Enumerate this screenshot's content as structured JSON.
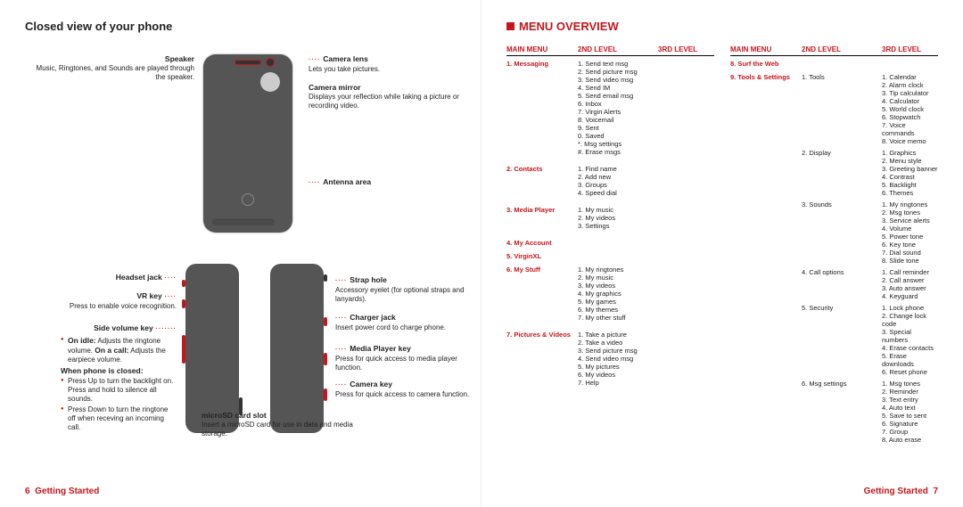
{
  "left": {
    "title": "Closed view of your phone",
    "labels": {
      "speaker": {
        "h": "Speaker",
        "d": "Music, Ringtones, and Sounds are played through the speaker."
      },
      "camera_lens": {
        "h": "Camera lens",
        "d": "Lets you take pictures."
      },
      "camera_mirror": {
        "h": "Camera mirror",
        "d": "Displays your reflection while taking a picture or recording video."
      },
      "antenna": {
        "h": "Antenna area"
      },
      "headset": {
        "h": "Headset jack"
      },
      "vr": {
        "h": "VR key",
        "d": "Press to enable voice recognition."
      },
      "strap": {
        "h": "Strap hole",
        "d": "Accessory eyelet (for optional straps and lanyards)."
      },
      "side_vol": {
        "h": "Side volume key",
        "b1_label": "On idle:",
        "b1": "Adjusts the ringtone volume.",
        "b1b_label": "On a call:",
        "b1b": "Adjusts the earpiece volume.",
        "closed_h": "When phone is closed:",
        "c1": "Press Up to turn the backlight on. Press and hold to silence all sounds.",
        "c2": "Press Down to turn the ringtone off when receving an incoming call."
      },
      "charger": {
        "h": "Charger jack",
        "d": "Insert power cord to charge phone."
      },
      "media": {
        "h": "Media Player key",
        "d": "Press for quick access to media player function."
      },
      "camera_key": {
        "h": "Camera key",
        "d": "Press for quick access to camera function."
      },
      "sd": {
        "h": "microSD card slot",
        "d": "Insert a microSD card for use in data and media storage."
      }
    },
    "footer_page": "6",
    "footer_section": "Getting Started"
  },
  "right": {
    "title": "MENU OVERVIEW",
    "headers": {
      "main": "MAIN MENU",
      "l2": "2ND LEVEL",
      "l3": "3RD LEVEL"
    },
    "col1": [
      {
        "main": "1. Messaging",
        "sub": [
          {
            "l2": [
              "1. Send text msg",
              "2. Send picture msg",
              "3. Send video msg",
              "4. Send IM",
              "5. Send email msg",
              "6. Inbox",
              "7. Virgin Alerts",
              "8. Voicemail",
              "9. Sent",
              "0. Saved",
              "*. Msg settings",
              "#. Erase msgs"
            ],
            "l3": []
          }
        ]
      },
      {
        "main": "2. Contacts",
        "sub": [
          {
            "l2": [
              "1. Find name",
              "2. Add new",
              "3. Groups",
              "4. Speed dial"
            ],
            "l3": []
          }
        ]
      },
      {
        "main": "3. Media Player",
        "sub": [
          {
            "l2": [
              "1. My music",
              "2. My videos",
              "3. Settings"
            ],
            "l3": []
          }
        ]
      },
      {
        "main": "4. My Account",
        "sub": []
      },
      {
        "main": "5. VirginXL",
        "sub": []
      },
      {
        "main": "6. My Stuff",
        "sub": [
          {
            "l2": [
              "1. My ringtones",
              "2. My music",
              "3. My videos",
              "4. My graphics",
              "5. My games",
              "6. My themes",
              "7. My other stuff"
            ],
            "l3": []
          }
        ]
      },
      {
        "main": "7. Pictures & Videos",
        "sub": [
          {
            "l2": [
              "1. Take a picture",
              "2. Take a video",
              "3. Send picture msg",
              "4. Send video msg",
              "5. My pictures",
              "6. My videos",
              "7. Help"
            ],
            "l3": []
          }
        ]
      }
    ],
    "col2": [
      {
        "main": "8. Surf the Web",
        "sub": []
      },
      {
        "main": "9. Tools & Settings",
        "sub": [
          {
            "l2": [
              "1. Tools"
            ],
            "l3": [
              "1. Calendar",
              "2. Alarm clock",
              "3. Tip calculator",
              "4. Calculator",
              "5. World clock",
              "6. Stopwatch",
              "7. Voice commands",
              "8. Voice memo"
            ]
          },
          {
            "l2": [
              "2. Display"
            ],
            "l3": [
              "1. Graphics",
              "2. Menu style",
              "3. Greeting banner",
              "4. Contrast",
              "5. Backlight",
              "6. Themes"
            ]
          },
          {
            "l2": [
              "3. Sounds"
            ],
            "l3": [
              "1. My ringtones",
              "2. Msg tones",
              "3. Service alerts",
              "4. Volume",
              "5. Power tone",
              "6. Key tone",
              "7. Dial sound",
              "8. Slide tone"
            ]
          },
          {
            "l2": [
              "4. Call options"
            ],
            "l3": [
              "1. Call reminder",
              "2. Call answer",
              "3. Auto answer",
              "4. Keyguard"
            ]
          },
          {
            "l2": [
              "5. Security"
            ],
            "l3": [
              "1. Lock phone",
              "2. Change lock code",
              "3. Special numbers",
              "4. Erase contacts",
              "5. Erase downloads",
              "6. Reset phone"
            ]
          },
          {
            "l2": [
              "6. Msg settings"
            ],
            "l3": [
              "1. Msg tones",
              "2. Reminder",
              "3. Text entry",
              "4. Auto text",
              "5. Save to sent",
              "6. Signature",
              "7. Group",
              "8. Auto erase"
            ]
          }
        ]
      }
    ],
    "footer_section": "Getting Started",
    "footer_page": "7"
  }
}
